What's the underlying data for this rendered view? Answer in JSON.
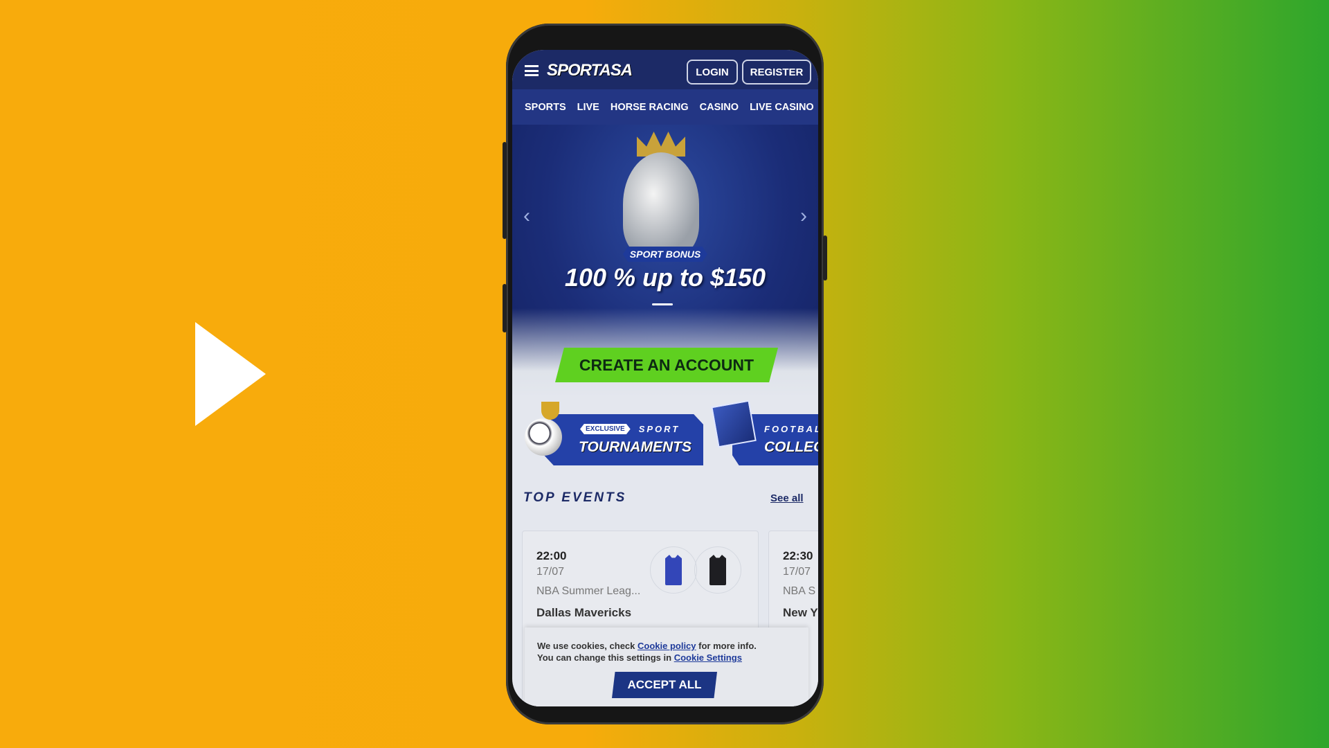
{
  "video": {
    "icon": "play-icon"
  },
  "header": {
    "logo": "SPORTASA",
    "login": "LOGIN",
    "register": "REGISTER",
    "menu_icon": "hamburger-icon"
  },
  "nav": [
    "SPORTS",
    "LIVE",
    "HORSE RACING",
    "CASINO",
    "LIVE CASINO"
  ],
  "banner": {
    "tag": "SPORT BONUS",
    "headline": "100 % up to $150",
    "cta": "CREATE AN ACCOUNT",
    "slide": 1
  },
  "promos": [
    {
      "badge": "EXCLUSIVE",
      "sub": "SPORT",
      "title": "TOURNAMENTS"
    },
    {
      "sub": "FOOTBAL",
      "title": "COLLEC"
    }
  ],
  "top_events": {
    "title": "TOP EVENTS",
    "see_all": "See all",
    "events": [
      {
        "time": "22:00",
        "date": "17/07",
        "league": "NBA Summer Leag...",
        "team": "Dallas Mavericks"
      },
      {
        "time": "22:30",
        "date": "17/07",
        "league": "NBA S",
        "team": "New Y"
      }
    ]
  },
  "cookie": {
    "text1": "We use cookies, check ",
    "link1": "Cookie policy",
    "text2": " for more info.",
    "text3": "You can change this settings in ",
    "link2": "Cookie Settings",
    "accept": "ACCEPT ALL"
  },
  "colors": {
    "header": "#1c2a66",
    "nav": "#233684",
    "cta": "#5fd020",
    "accent": "#2441a8"
  }
}
